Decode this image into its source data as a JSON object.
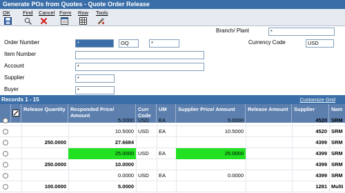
{
  "window": {
    "title": "Generate POs from Quotes - Quote Order Release"
  },
  "toolbar": [
    {
      "id": "ok",
      "label": "OK",
      "icon": "save-icon"
    },
    {
      "id": "find",
      "label": "Find",
      "icon": "find-icon"
    },
    {
      "id": "cancel",
      "label": "Cancel",
      "icon": "cancel-icon"
    },
    {
      "id": "form",
      "label": "Form",
      "icon": "form-icon"
    },
    {
      "id": "row",
      "label": "Row",
      "icon": "row-icon"
    },
    {
      "id": "tools",
      "label": "Tools",
      "icon": "tools-icon"
    }
  ],
  "form": {
    "branch_plant": {
      "label": "Branch/ Plant",
      "value": "*"
    },
    "order_number": {
      "label": "Order Number",
      "value": "*",
      "type": "OQ",
      "company": "*"
    },
    "currency_code": {
      "label": "Currency Code",
      "value": "USD"
    },
    "item_number": {
      "label": "Item Number",
      "value": ""
    },
    "account": {
      "label": "Account",
      "value": "*"
    },
    "supplier": {
      "label": "Supplier",
      "value": "*"
    },
    "buyer": {
      "label": "Buyer",
      "value": "*"
    }
  },
  "grid": {
    "records": "Records 1 - 15",
    "customize": "Customize Grid",
    "columns": [
      {
        "key": "release_qty",
        "label": "Release Quantity"
      },
      {
        "key": "responded_price",
        "label": "Responded Price/ Amount"
      },
      {
        "key": "curr_code",
        "label": "Curr Code"
      },
      {
        "key": "um",
        "label": "UM"
      },
      {
        "key": "supplier_price",
        "label": "Supplier Price/ Amount"
      },
      {
        "key": "release_amount",
        "label": "Release Amount"
      },
      {
        "key": "supplier",
        "label": "Supplier"
      },
      {
        "key": "name",
        "label": "Nam"
      }
    ],
    "rows": [
      {
        "release_qty": "",
        "responded_price": "5.0000",
        "curr_code": "USD",
        "um": "EA",
        "supplier_price": "5.0000",
        "release_amount": "",
        "supplier": "4520",
        "name": "SRM",
        "bold": false,
        "highlight": false
      },
      {
        "release_qty": "",
        "responded_price": "10.5000",
        "curr_code": "USD",
        "um": "EA",
        "supplier_price": "10.5000",
        "release_amount": "",
        "supplier": "4520",
        "name": "SRM",
        "bold": false,
        "highlight": false
      },
      {
        "release_qty": "250.0000",
        "responded_price": "27.6684",
        "curr_code": "",
        "um": "",
        "supplier_price": "",
        "release_amount": "",
        "supplier": "4399",
        "name": "SRM",
        "bold": true,
        "highlight": false
      },
      {
        "release_qty": "",
        "responded_price": "25.0000",
        "curr_code": "USD",
        "um": "EA",
        "supplier_price": "25.0000",
        "release_amount": "",
        "supplier": "4399",
        "name": "SRM",
        "bold": false,
        "highlight": true
      },
      {
        "release_qty": "250.0000",
        "responded_price": "10.0000",
        "curr_code": "",
        "um": "",
        "supplier_price": "",
        "release_amount": "",
        "supplier": "4399",
        "name": "SRM",
        "bold": true,
        "highlight": false
      },
      {
        "release_qty": "",
        "responded_price": "0.0000",
        "curr_code": "USD",
        "um": "EA",
        "supplier_price": "0.0000",
        "release_amount": "",
        "supplier": "4399",
        "name": "SRM",
        "bold": false,
        "highlight": false
      },
      {
        "release_qty": "100.0000",
        "responded_price": "5.0000",
        "curr_code": "",
        "um": "",
        "supplier_price": "",
        "release_amount": "",
        "supplier": "1281",
        "name": "Multi",
        "bold": true,
        "highlight": false
      }
    ]
  }
}
